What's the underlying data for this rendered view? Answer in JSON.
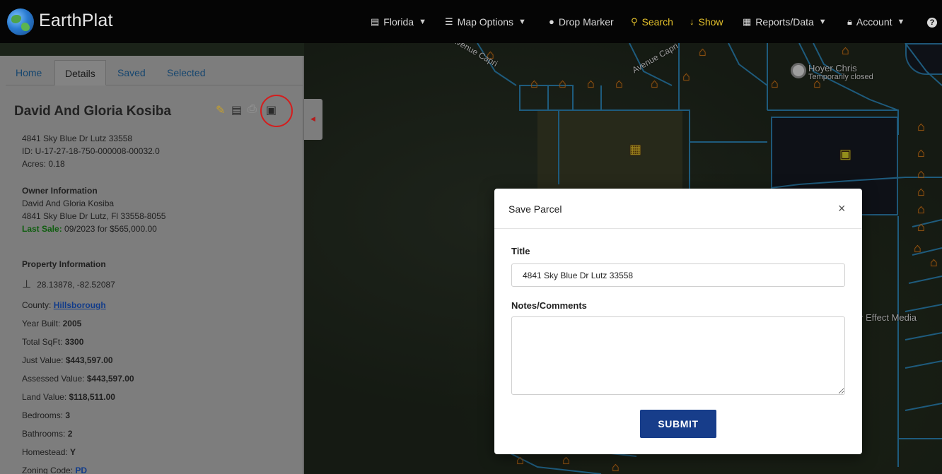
{
  "app": {
    "brand": "EarthPlat"
  },
  "nav": {
    "florida": "Florida",
    "map_options": "Map Options",
    "drop_marker": "Drop Marker",
    "search": "Search",
    "show": "Show",
    "reports": "Reports/Data",
    "account": "Account",
    "help": "?"
  },
  "map": {
    "labels": {
      "avenue_capri_1": "Avenue Capri",
      "avenue_capri_2": "Avenue Capri",
      "hoyer_name": "Hoyer Chris",
      "hoyer_status": "Temporarily closed",
      "effect_media": "r Effect Media"
    }
  },
  "tabs": [
    "Home",
    "Details",
    "Saved",
    "Selected"
  ],
  "details": {
    "title": "David And Gloria Kosiba",
    "address": "4841 Sky Blue Dr Lutz 33558",
    "id": "ID: U-17-27-18-750-000008-00032.0",
    "acres": "Acres: 0.18",
    "owner_heading": "Owner Information",
    "owner_name": "David And Gloria Kosiba",
    "owner_address": "4841 Sky Blue Dr Lutz, Fl 33558-8055",
    "last_sale_label": "Last Sale:",
    "last_sale_value": "09/2023 for $565,000.00",
    "property_heading": "Property Information",
    "coords": "28.13878, -82.52087",
    "county_label": "County:",
    "county_value": "Hillsborough",
    "year_built_label": "Year Built:",
    "year_built_value": "2005",
    "sqft_label": "Total SqFt:",
    "sqft_value": "3300",
    "just_label": "Just Value:",
    "just_value": "$443,597.00",
    "assessed_label": "Assessed Value:",
    "assessed_value": "$443,597.00",
    "land_label": "Land Value:",
    "land_value": "$118,511.00",
    "bed_label": "Bedrooms:",
    "bed_value": "3",
    "bath_label": "Bathrooms:",
    "bath_value": "2",
    "homestead_label": "Homestead:",
    "homestead_value": "Y",
    "zoning_label": "Zoning Code:",
    "zoning_value": "PD"
  },
  "modal": {
    "title": "Save Parcel",
    "close": "×",
    "title_label": "Title",
    "title_value": "4841 Sky Blue Dr Lutz 33558",
    "notes_label": "Notes/Comments",
    "notes_value": "",
    "submit": "SUBMIT"
  },
  "colors": {
    "accent": "#173d8a",
    "highlight": "#d41e1e",
    "nav_yellow": "#e4c12b",
    "parcel_lines": "#2d86b8"
  }
}
